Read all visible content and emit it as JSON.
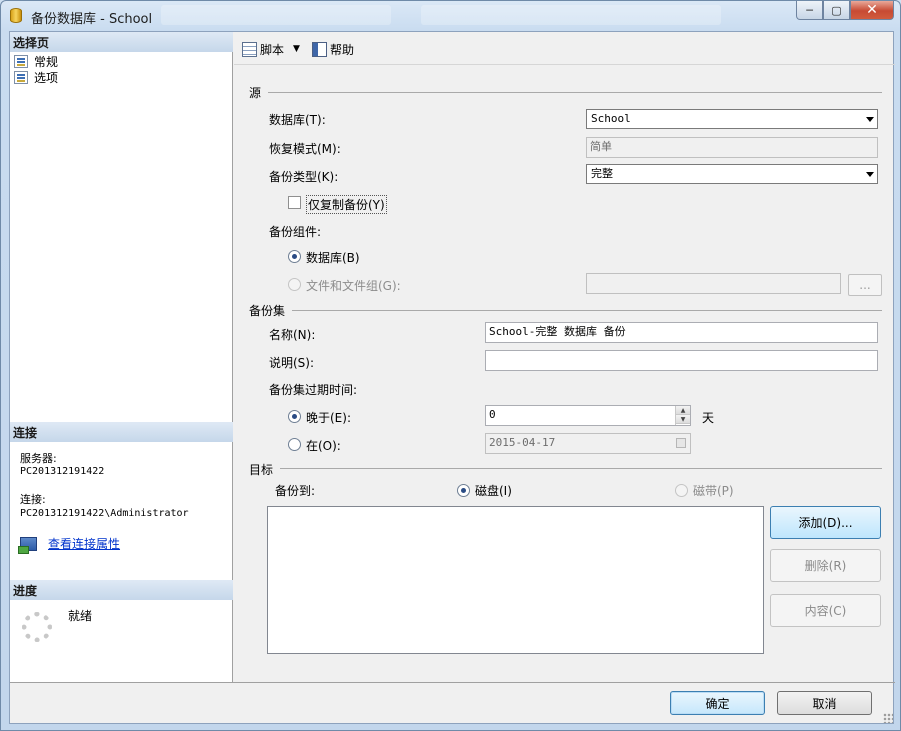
{
  "window": {
    "title": "备份数据库 - School",
    "controls": {
      "minimize": "─",
      "maximize": "▢",
      "close": "✕"
    }
  },
  "left": {
    "select_page_header": "选择页",
    "pages": [
      {
        "label": "常规",
        "icon": "page-icon"
      },
      {
        "label": "选项",
        "icon": "page-icon"
      }
    ],
    "connection": {
      "header": "连接",
      "server_label": "服务器:",
      "server_value": "PC201312191422",
      "conn_label": "连接:",
      "conn_value": "PC201312191422\\Administrator",
      "view_link": "查看连接属性"
    },
    "progress": {
      "header": "进度",
      "status": "就绪"
    }
  },
  "toolbar": {
    "script_label": "脚本",
    "help_label": "帮助"
  },
  "source": {
    "title": "源",
    "database_label": "数据库(T):",
    "database_value": "School",
    "recovery_label": "恢复模式(M):",
    "recovery_value": "简单",
    "backup_type_label": "备份类型(K):",
    "backup_type_value": "完整",
    "copy_only_label": "仅复制备份(Y)",
    "component_label": "备份组件:",
    "component_db_label": "数据库(B)",
    "component_files_label": "文件和文件组(G):",
    "files_browse": "..."
  },
  "backup_set": {
    "title": "备份集",
    "name_label": "名称(N):",
    "name_value": "School-完整 数据库 备份",
    "desc_label": "说明(S):",
    "desc_value": "",
    "expire_label": "备份集过期时间:",
    "after_label": "晚于(E):",
    "after_value": "0",
    "after_unit": "天",
    "on_label": "在(O):",
    "on_value": "2015-04-17"
  },
  "destination": {
    "title": "目标",
    "backup_to_label": "备份到:",
    "disk_label": "磁盘(I)",
    "tape_label": "磁带(P)",
    "add_button": "添加(D)...",
    "remove_button": "删除(R)",
    "contents_button": "内容(C)"
  },
  "footer": {
    "ok": "确定",
    "cancel": "取消"
  }
}
